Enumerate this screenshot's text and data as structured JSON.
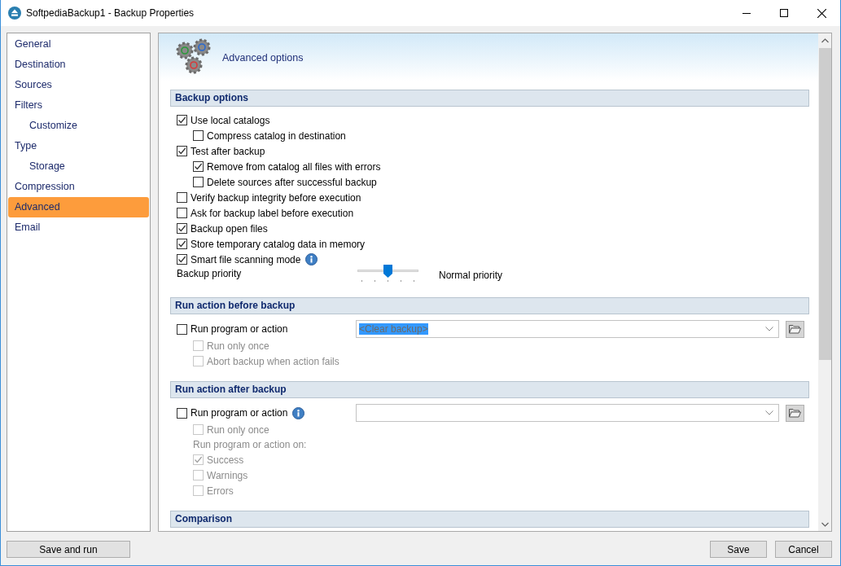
{
  "window": {
    "title": "SoftpediaBackup1 - Backup Properties"
  },
  "sidebar": {
    "items": [
      {
        "label": "General",
        "selected": false
      },
      {
        "label": "Destination",
        "selected": false
      },
      {
        "label": "Sources",
        "selected": false
      },
      {
        "label": "Filters",
        "selected": false,
        "children": [
          {
            "label": "Customize",
            "selected": false
          }
        ]
      },
      {
        "label": "Type",
        "selected": false,
        "children": [
          {
            "label": "Storage",
            "selected": false
          }
        ]
      },
      {
        "label": "Compression",
        "selected": false
      },
      {
        "label": "Advanced",
        "selected": true
      },
      {
        "label": "Email",
        "selected": false
      }
    ]
  },
  "panel_header": {
    "title": "Advanced options"
  },
  "sections": [
    {
      "title": "Backup options",
      "items": [
        {
          "kind": "checkbox",
          "label": "Use local catalogs",
          "checked": true,
          "disabled": false,
          "children": [
            {
              "kind": "checkbox",
              "label": "Compress catalog in destination",
              "checked": false,
              "disabled": false
            }
          ]
        },
        {
          "kind": "checkbox",
          "label": "Test after backup",
          "checked": true,
          "disabled": false,
          "children": [
            {
              "kind": "checkbox",
              "label": "Remove from catalog all files with errors",
              "checked": true,
              "disabled": false
            },
            {
              "kind": "checkbox",
              "label": "Delete sources after successful backup",
              "checked": false,
              "disabled": false
            }
          ]
        },
        {
          "kind": "checkbox",
          "label": "Verify backup integrity before execution",
          "checked": false,
          "disabled": false
        },
        {
          "kind": "checkbox",
          "label": "Ask for backup label before execution",
          "checked": false,
          "disabled": false
        },
        {
          "kind": "checkbox",
          "label": "Backup open files",
          "checked": true,
          "disabled": false
        },
        {
          "kind": "checkbox",
          "label": "Store temporary catalog data in memory",
          "checked": true,
          "disabled": false
        },
        {
          "kind": "checkbox",
          "label": "Smart file scanning mode",
          "checked": true,
          "disabled": false,
          "info": true
        },
        {
          "kind": "slider",
          "label": "Backup priority",
          "level": 0.5,
          "reading": "Normal priority"
        }
      ]
    },
    {
      "title": "Run action before backup",
      "items": [
        {
          "kind": "action",
          "label": "Run program or action",
          "checked": false,
          "disabled": false,
          "combo": {
            "value": "<Clear backup>",
            "highlighted": true
          },
          "children": [
            {
              "kind": "checkbox",
              "label": "Run only once",
              "checked": false,
              "disabled": true
            },
            {
              "kind": "checkbox",
              "label": "Abort backup when action fails",
              "checked": false,
              "disabled": true
            }
          ]
        }
      ]
    },
    {
      "title": "Run action after backup",
      "items": [
        {
          "kind": "action",
          "label": "Run program or action",
          "checked": false,
          "disabled": false,
          "info": true,
          "children": [
            {
              "kind": "checkbox",
              "label": "Run only once",
              "checked": false,
              "disabled": true
            },
            {
              "kind": "note",
              "text": "Run program or action on:",
              "disabled": true
            },
            {
              "kind": "checkbox",
              "label": "Success",
              "checked": true,
              "disabled": true
            },
            {
              "kind": "checkbox",
              "label": "Warnings",
              "checked": false,
              "disabled": true
            },
            {
              "kind": "checkbox",
              "label": "Errors",
              "checked": false,
              "disabled": true
            }
          ]
        }
      ]
    },
    {
      "title": "Comparison"
    }
  ],
  "footer": {
    "left_buttons": [
      "Save and run"
    ],
    "right_buttons": [
      "Save",
      "Cancel"
    ]
  }
}
